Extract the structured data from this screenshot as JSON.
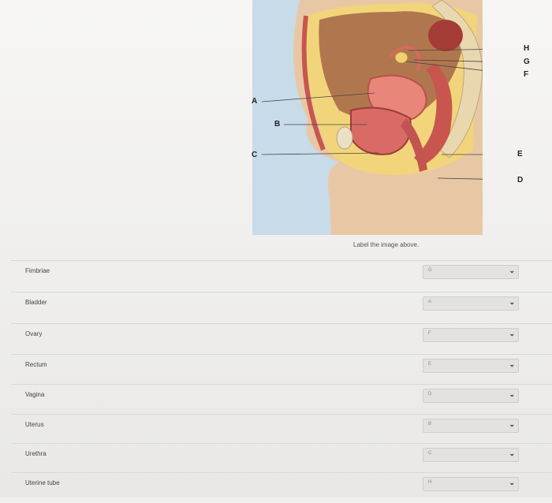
{
  "figure": {
    "label_letters": [
      "A",
      "B",
      "C",
      "D",
      "E",
      "F",
      "G",
      "H"
    ],
    "caption": "Label the image above."
  },
  "rows": [
    {
      "term": "Fimbriae",
      "selected": "G"
    },
    {
      "term": "Bladder",
      "selected": "A"
    },
    {
      "term": "Ovary",
      "selected": "F"
    },
    {
      "term": "Rectum",
      "selected": "E"
    },
    {
      "term": "Vagina",
      "selected": "D"
    },
    {
      "term": "Uterus",
      "selected": "B"
    },
    {
      "term": "Urethra",
      "selected": "C"
    },
    {
      "term": "Uterine tube",
      "selected": "H"
    }
  ],
  "dropdown_icon": "chevron-down-icon",
  "colors": {
    "figure_bg": "#c7dbe8",
    "skin": "#e8c8a4",
    "tissue_red": "#c9564e",
    "fat_yellow": "#f2d57a",
    "select_bg": "#e3e2df"
  }
}
